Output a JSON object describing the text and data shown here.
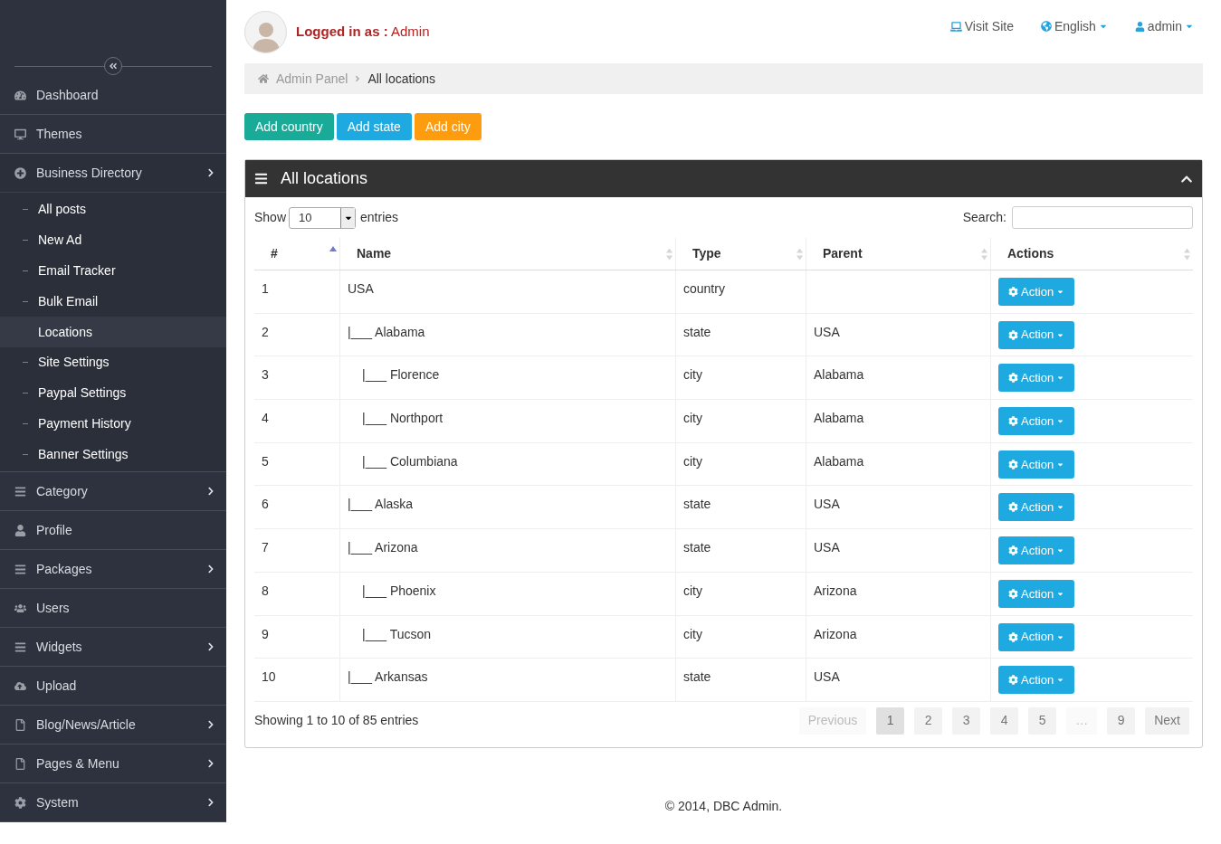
{
  "sidebar": {
    "items": [
      {
        "label": "Dashboard",
        "has_submenu": false
      },
      {
        "label": "Themes",
        "has_submenu": false
      },
      {
        "label": "Business Directory",
        "has_submenu": true,
        "expanded": true,
        "children": [
          {
            "label": "All posts",
            "selected": false
          },
          {
            "label": "New Ad",
            "selected": false
          },
          {
            "label": "Email Tracker",
            "selected": false
          },
          {
            "label": "Bulk Email",
            "selected": false
          },
          {
            "label": "Locations",
            "selected": true
          },
          {
            "label": "Site Settings",
            "selected": false
          },
          {
            "label": "Paypal Settings",
            "selected": false
          },
          {
            "label": "Payment History",
            "selected": false
          },
          {
            "label": "Banner Settings",
            "selected": false
          }
        ]
      },
      {
        "label": "Category",
        "has_submenu": true,
        "expanded": false
      },
      {
        "label": "Profile",
        "has_submenu": false
      },
      {
        "label": "Packages",
        "has_submenu": true,
        "expanded": false
      },
      {
        "label": "Users",
        "has_submenu": false
      },
      {
        "label": "Widgets",
        "has_submenu": true,
        "expanded": false
      },
      {
        "label": "Upload",
        "has_submenu": false
      },
      {
        "label": "Blog/News/Article",
        "has_submenu": true,
        "expanded": false
      },
      {
        "label": "Pages & Menu",
        "has_submenu": true,
        "expanded": false
      },
      {
        "label": "System",
        "has_submenu": true,
        "expanded": false
      }
    ]
  },
  "header": {
    "logged_in_label": "Logged in as :",
    "user": "Admin",
    "links": [
      {
        "label": "Visit Site",
        "dropdown": false
      },
      {
        "label": "English",
        "dropdown": true
      },
      {
        "label": "admin",
        "dropdown": true
      }
    ]
  },
  "breadcrumb": [
    "Admin Panel",
    "All locations"
  ],
  "buttons": [
    {
      "label": "Add country",
      "color": "#1aaa98"
    },
    {
      "label": "Add state",
      "color": "#1fa9e1"
    },
    {
      "label": "Add city",
      "color": "#fd9c0e"
    }
  ],
  "panel": {
    "title": "All locations",
    "expanded": true
  },
  "table_controls": {
    "show_label": "Show",
    "page_size": "10",
    "entries_label": "entries",
    "search_label": "Search:"
  },
  "table": {
    "columns": [
      {
        "label": "#",
        "sorted": true
      },
      {
        "label": "Name",
        "sorted": false
      },
      {
        "label": "Type",
        "sorted": false
      },
      {
        "label": "Parent",
        "sorted": false
      },
      {
        "label": "Actions",
        "sorted": false
      }
    ],
    "rows": [
      {
        "id": "1",
        "name": "USA",
        "indented": false,
        "type": "country",
        "parent": "",
        "action": "Action"
      },
      {
        "id": "2",
        "name": "|___ Alabama",
        "indented": false,
        "type": "state",
        "parent": "USA",
        "action": "Action"
      },
      {
        "id": "3",
        "name": "|___ Florence",
        "indented": true,
        "type": "city",
        "parent": "Alabama",
        "action": "Action"
      },
      {
        "id": "4",
        "name": "|___ Northport",
        "indented": true,
        "type": "city",
        "parent": "Alabama",
        "action": "Action"
      },
      {
        "id": "5",
        "name": "|___ Columbiana",
        "indented": true,
        "type": "city",
        "parent": "Alabama",
        "action": "Action"
      },
      {
        "id": "6",
        "name": "|___ Alaska",
        "indented": false,
        "type": "state",
        "parent": "USA",
        "action": "Action"
      },
      {
        "id": "7",
        "name": "|___ Arizona",
        "indented": false,
        "type": "state",
        "parent": "USA",
        "action": "Action"
      },
      {
        "id": "8",
        "name": "|___ Phoenix",
        "indented": true,
        "type": "city",
        "parent": "Arizona",
        "action": "Action"
      },
      {
        "id": "9",
        "name": "|___ Tucson",
        "indented": true,
        "type": "city",
        "parent": "Arizona",
        "action": "Action"
      },
      {
        "id": "10",
        "name": "|___ Arkansas",
        "indented": false,
        "type": "state",
        "parent": "USA",
        "action": "Action"
      }
    ]
  },
  "info": "Showing 1 to 10 of 85 entries",
  "pagination": [
    {
      "label": "Previous",
      "selected": false,
      "disabled": true
    },
    {
      "label": "1",
      "selected": true,
      "disabled": false
    },
    {
      "label": "2",
      "selected": false,
      "disabled": false
    },
    {
      "label": "3",
      "selected": false,
      "disabled": false
    },
    {
      "label": "4",
      "selected": false,
      "disabled": false
    },
    {
      "label": "5",
      "selected": false,
      "disabled": false
    },
    {
      "label": "…",
      "selected": false,
      "disabled": true
    },
    {
      "label": "9",
      "selected": false,
      "disabled": false
    },
    {
      "label": "Next",
      "selected": false,
      "disabled": false
    }
  ],
  "footer": "© 2014, DBC Admin."
}
